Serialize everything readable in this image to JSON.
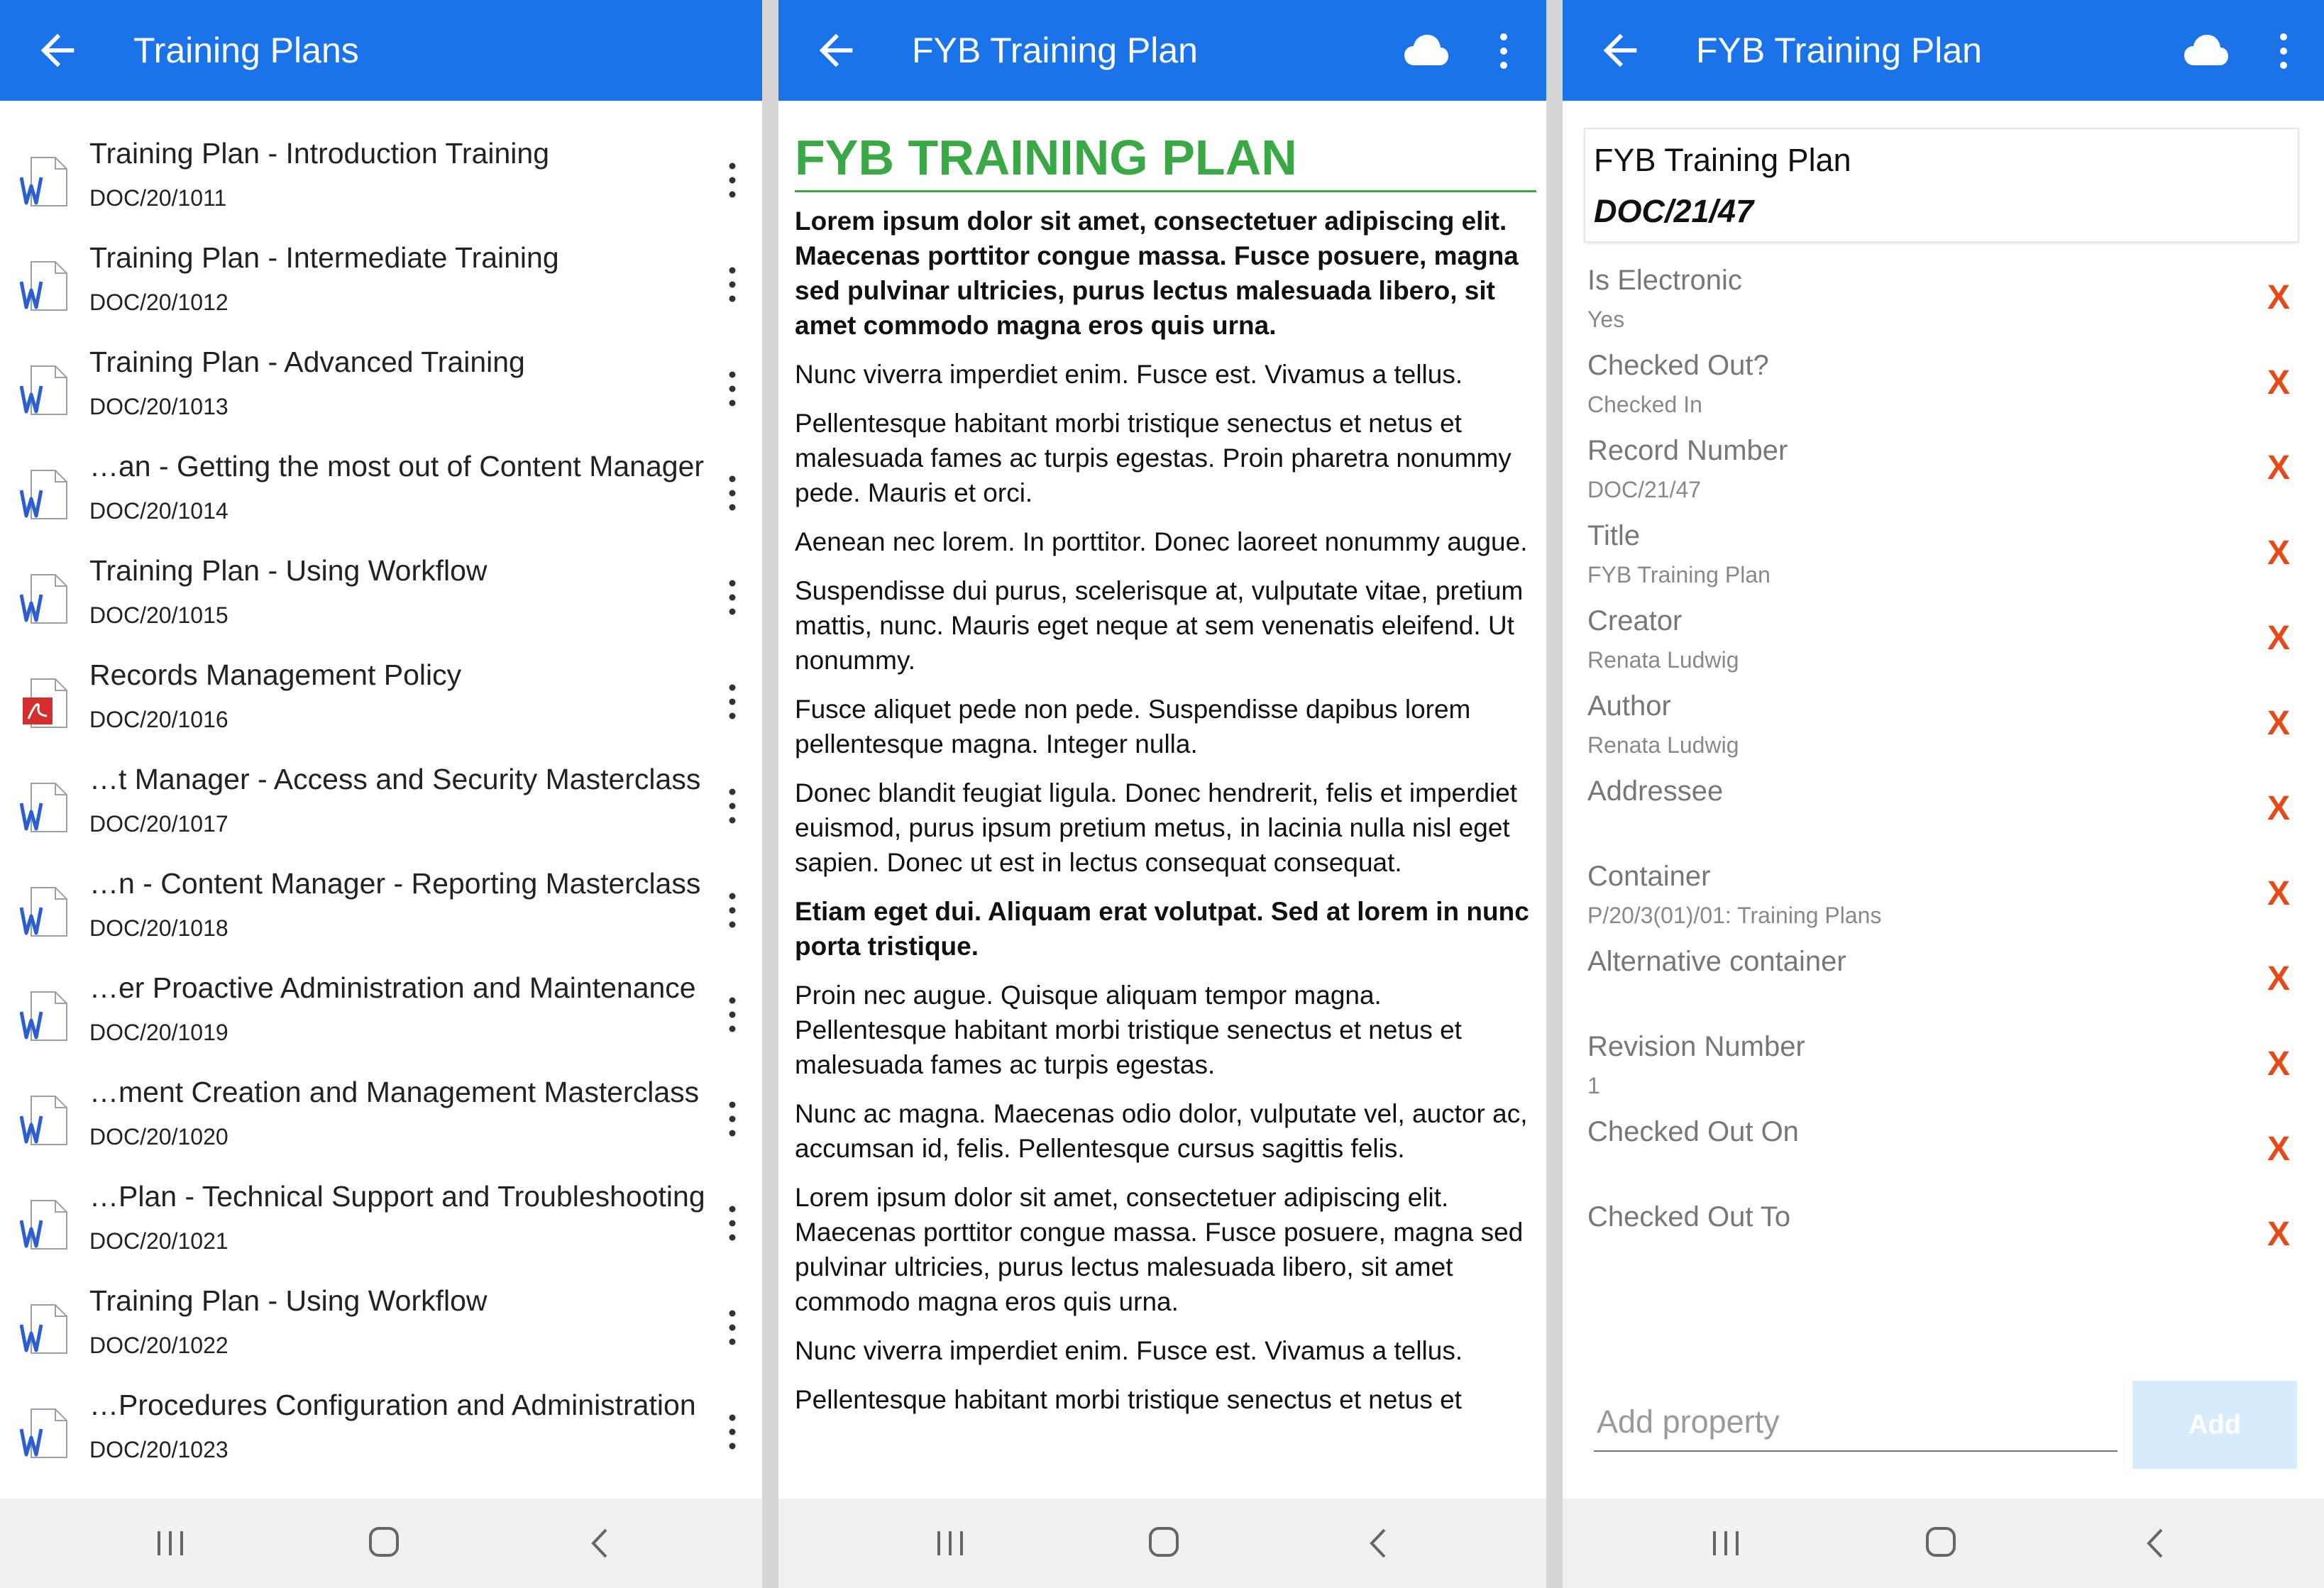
{
  "screen1": {
    "title": "Training Plans",
    "items": [
      {
        "title": "Training Plan - Introduction Training",
        "number": "DOC/20/1011",
        "type": "word-icon"
      },
      {
        "title": "Training Plan - Intermediate Training",
        "number": "DOC/20/1012",
        "type": "word-icon"
      },
      {
        "title": "Training Plan - Advanced Training",
        "number": "DOC/20/1013",
        "type": "word-icon"
      },
      {
        "title": "…an - Getting the most out of Content Manager",
        "number": "DOC/20/1014",
        "type": "word-icon"
      },
      {
        "title": "Training Plan - Using Workflow",
        "number": "DOC/20/1015",
        "type": "word-icon"
      },
      {
        "title": "Records Management Policy",
        "number": "DOC/20/1016",
        "type": "pdf-icon"
      },
      {
        "title": "…t Manager - Access and Security Masterclass",
        "number": "DOC/20/1017",
        "type": "word-icon"
      },
      {
        "title": "…n - Content Manager - Reporting Masterclass",
        "number": "DOC/20/1018",
        "type": "word-icon"
      },
      {
        "title": "…er Proactive Administration and Maintenance",
        "number": "DOC/20/1019",
        "type": "word-icon"
      },
      {
        "title": "…ment Creation and Management Masterclass",
        "number": "DOC/20/1020",
        "type": "word-icon"
      },
      {
        "title": "…Plan - Technical Support and Troubleshooting",
        "number": "DOC/20/1021",
        "type": "word-icon"
      },
      {
        "title": "Training Plan - Using Workflow",
        "number": "DOC/20/1022",
        "type": "word-icon"
      },
      {
        "title": "…Procedures Configuration and Administration",
        "number": "DOC/20/1023",
        "type": "word-icon"
      }
    ]
  },
  "screen2": {
    "title": "FYB Training Plan",
    "heading": "FYB TRAINING PLAN",
    "paragraphs": [
      {
        "bold": true,
        "text": "Lorem ipsum dolor sit amet, consectetuer adipiscing elit. Maecenas porttitor congue massa. Fusce posuere, magna sed pulvinar ultricies, purus lectus malesuada libero, sit amet commodo magna eros quis urna."
      },
      {
        "bold": false,
        "text": "Nunc viverra imperdiet enim. Fusce est. Vivamus a tellus."
      },
      {
        "bold": false,
        "text": "Pellentesque habitant morbi tristique senectus et netus et malesuada fames ac turpis egestas. Proin pharetra nonummy pede. Mauris et orci."
      },
      {
        "bold": false,
        "text": "Aenean nec lorem. In porttitor. Donec laoreet nonummy augue."
      },
      {
        "bold": false,
        "text": "Suspendisse dui purus, scelerisque at, vulputate vitae, pretium mattis, nunc. Mauris eget neque at sem venenatis eleifend. Ut nonummy."
      },
      {
        "bold": false,
        "text": "Fusce aliquet pede non pede. Suspendisse dapibus lorem pellentesque magna. Integer nulla."
      },
      {
        "bold": false,
        "text": "Donec blandit feugiat ligula. Donec hendrerit, felis et imperdiet euismod, purus ipsum pretium metus, in lacinia nulla nisl eget sapien. Donec ut est in lectus consequat consequat."
      },
      {
        "bold": true,
        "text": "Etiam eget dui. Aliquam erat volutpat. Sed at lorem in nunc porta tristique."
      },
      {
        "bold": false,
        "text": "Proin nec augue. Quisque aliquam tempor magna. Pellentesque habitant morbi tristique senectus et netus et malesuada fames ac turpis egestas."
      },
      {
        "bold": false,
        "text": "Nunc ac magna. Maecenas odio dolor, vulputate vel, auctor ac, accumsan id, felis. Pellentesque cursus sagittis felis."
      },
      {
        "bold": false,
        "text": "Lorem ipsum dolor sit amet, consectetuer adipiscing elit. Maecenas porttitor congue massa. Fusce posuere, magna sed pulvinar ultricies, purus lectus malesuada libero, sit amet commodo magna eros quis urna."
      },
      {
        "bold": false,
        "text": "Nunc viverra imperdiet enim. Fusce est. Vivamus a tellus."
      },
      {
        "bold": false,
        "text": "Pellentesque habitant morbi tristique senectus et netus et"
      }
    ]
  },
  "screen3": {
    "title": "FYB Training Plan",
    "header_title": "FYB Training Plan",
    "header_number": "DOC/21/47",
    "properties": [
      {
        "label": "Is Electronic",
        "value": "Yes"
      },
      {
        "label": "Checked Out?",
        "value": "Checked In"
      },
      {
        "label": "Record Number",
        "value": "DOC/21/47"
      },
      {
        "label": "Title",
        "value": "FYB Training Plan"
      },
      {
        "label": "Creator",
        "value": "Renata Ludwig"
      },
      {
        "label": "Author",
        "value": "Renata Ludwig"
      },
      {
        "label": "Addressee",
        "value": ""
      },
      {
        "label": "Container",
        "value": "P/20/3(01)/01: Training Plans"
      },
      {
        "label": "Alternative container",
        "value": ""
      },
      {
        "label": "Revision Number",
        "value": "1"
      },
      {
        "label": "Checked Out On",
        "value": ""
      },
      {
        "label": "Checked Out To",
        "value": ""
      }
    ],
    "remove_symbol": "X",
    "add_placeholder": "Add property",
    "add_label": "Add"
  },
  "colors": {
    "appbar": "#1a73e8",
    "heading_green": "#3aa845",
    "remove_orange": "#e64a19",
    "add_button_disabled": "#d6ecfb"
  }
}
